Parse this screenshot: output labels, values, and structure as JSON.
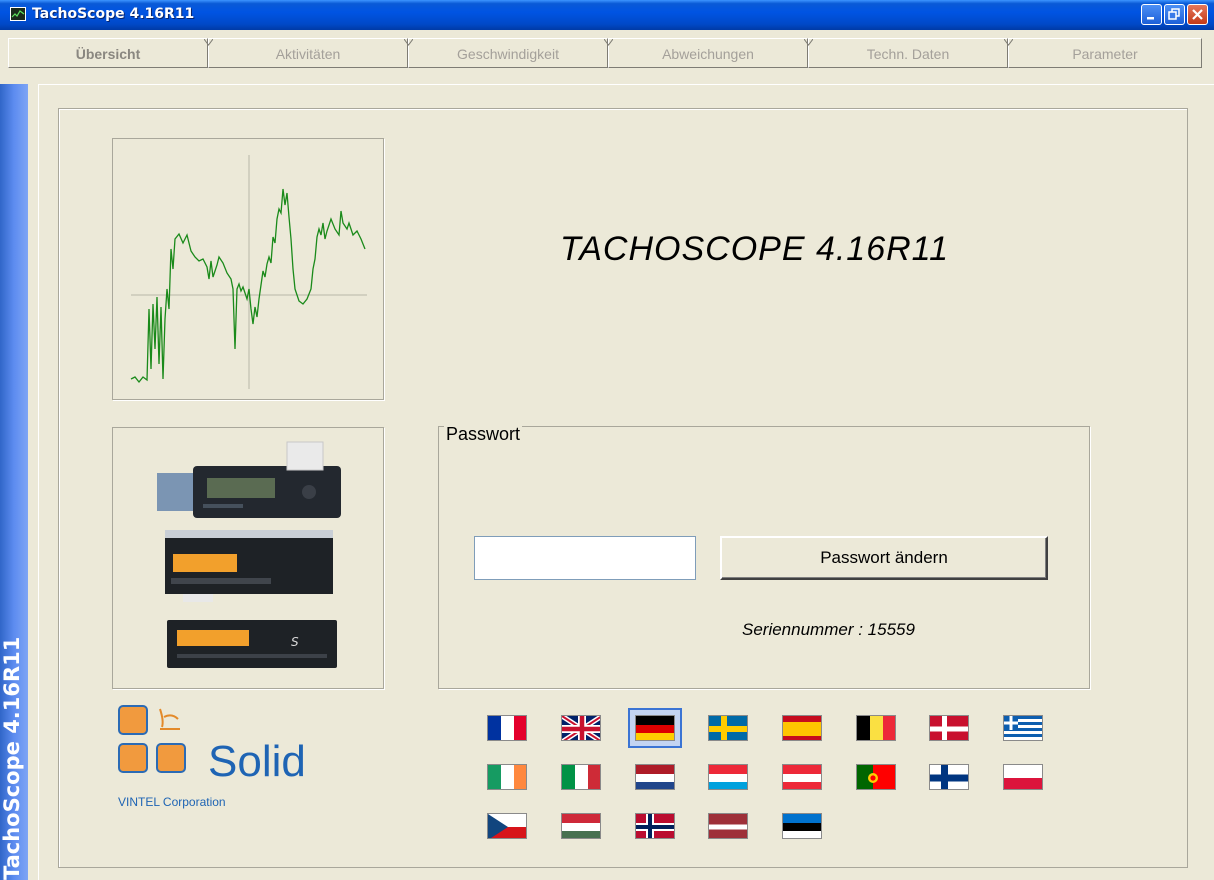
{
  "window": {
    "title": "TachoScope 4.16R11"
  },
  "tabs": [
    {
      "label": "Übersicht",
      "active": true
    },
    {
      "label": "Aktivitäten",
      "active": false
    },
    {
      "label": "Geschwindigkeit",
      "active": false
    },
    {
      "label": "Abweichungen",
      "active": false
    },
    {
      "label": "Techn. Daten",
      "active": false
    },
    {
      "label": "Parameter",
      "active": false
    }
  ],
  "sidebar": {
    "vertical_title": "TachoScope 4.16R11"
  },
  "main": {
    "app_title": "TACHOSCOPE  4.16R11",
    "password_group_label": "Passwort",
    "password_value": "",
    "change_password_button_label": "Passwort ändern",
    "serial_number": "Seriennummer : 15559"
  },
  "logo": {
    "brand": "Solid",
    "corporation": "VINTEL Corporation"
  },
  "languages": [
    {
      "flag": "france",
      "selected": false
    },
    {
      "flag": "united-kingdom",
      "selected": false
    },
    {
      "flag": "germany",
      "selected": true
    },
    {
      "flag": "sweden",
      "selected": false
    },
    {
      "flag": "spain",
      "selected": false
    },
    {
      "flag": "belgium",
      "selected": false
    },
    {
      "flag": "denmark",
      "selected": false
    },
    {
      "flag": "greece",
      "selected": false
    },
    {
      "flag": "ireland",
      "selected": false
    },
    {
      "flag": "italy",
      "selected": false
    },
    {
      "flag": "netherlands",
      "selected": false
    },
    {
      "flag": "luxembourg",
      "selected": false
    },
    {
      "flag": "austria",
      "selected": false
    },
    {
      "flag": "portugal",
      "selected": false
    },
    {
      "flag": "finland",
      "selected": false
    },
    {
      "flag": "poland",
      "selected": false
    },
    {
      "flag": "czech-republic",
      "selected": false
    },
    {
      "flag": "hungary",
      "selected": false
    },
    {
      "flag": "norway",
      "selected": false
    },
    {
      "flag": "latvia",
      "selected": false
    },
    {
      "flag": "estonia",
      "selected": false
    }
  ],
  "colors": {
    "window_face": "#ece9d8",
    "titlebar_blue": "#0054e3",
    "graph_line": "#1a8a1a",
    "logo_orange": "#f19a3e",
    "logo_blue": "#1e64b4"
  }
}
